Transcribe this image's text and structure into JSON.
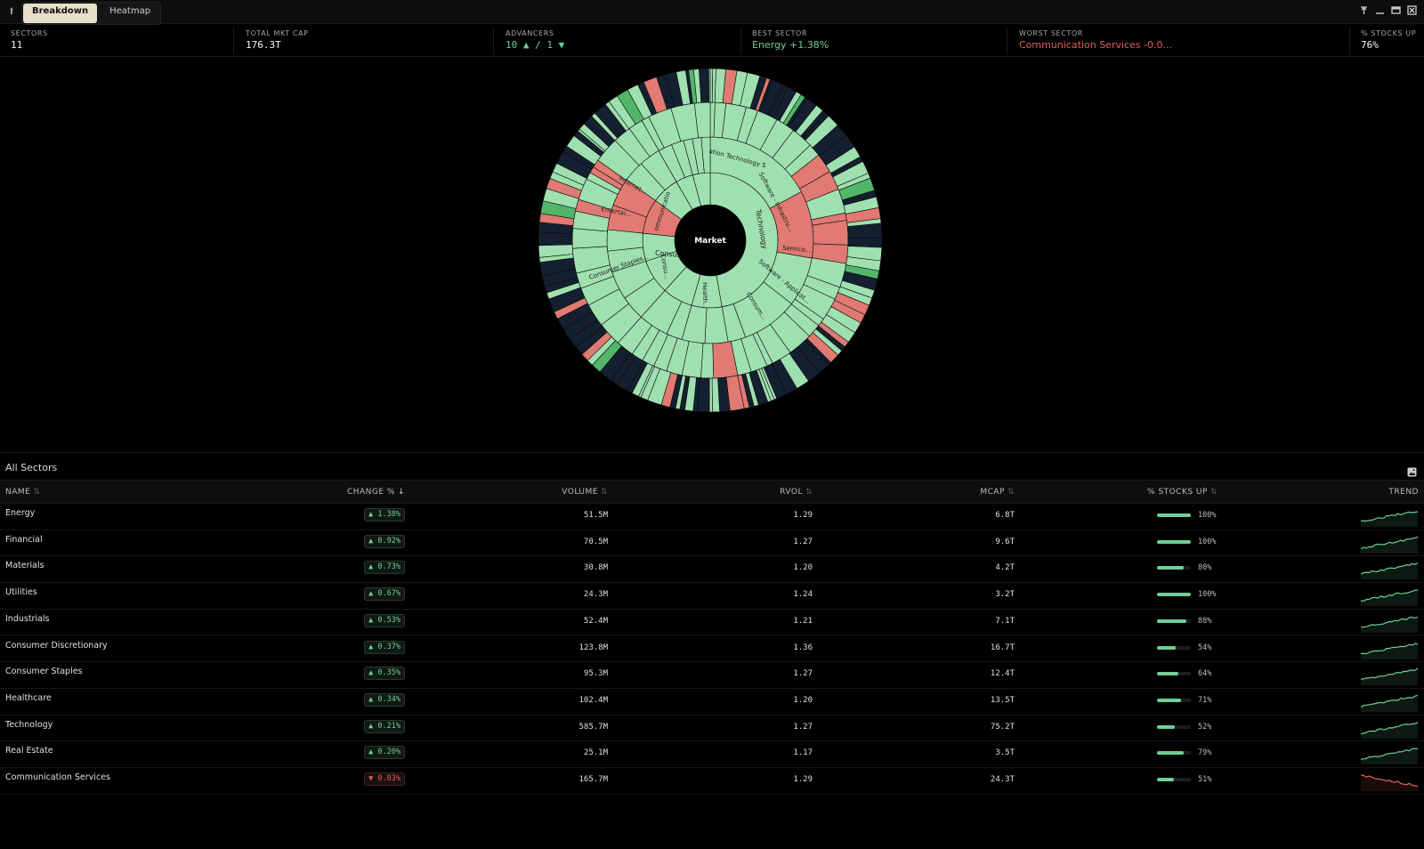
{
  "window": {
    "tabs": [
      {
        "label": "Breakdown",
        "active": true
      },
      {
        "label": "Heatmap",
        "active": false
      }
    ],
    "controls": [
      "pin-icon",
      "minimize-icon",
      "maximize-icon",
      "close-icon"
    ]
  },
  "stats": [
    {
      "label": "SECTORS",
      "value": "11",
      "tone": "neutral"
    },
    {
      "label": "TOTAL MKT CAP",
      "value": "176.3T",
      "tone": "neutral"
    },
    {
      "label": "ADVANCERS",
      "value": "10 ▲ / 1 ▼",
      "tone": "pos"
    },
    {
      "label": "BEST SECTOR",
      "value": "Energy +1.38%",
      "tone": "pos"
    },
    {
      "label": "WORST SECTOR",
      "value": "Communication Services -0.0...",
      "tone": "neg"
    },
    {
      "label": "% STOCKS UP",
      "value": "76%",
      "tone": "neutral"
    }
  ],
  "sunburst": {
    "center_label": "Market",
    "labels": [
      "ation Technology S",
      "Software - Infrastru...",
      "Technology",
      "Semico...",
      "Software - Applicat...",
      "Consum...",
      "Health...",
      "Consu...",
      "Consu...",
      "Consumer Staples...",
      "Entertai...",
      "Internet...",
      "ommunicatio"
    ],
    "colors": {
      "up": "#9fe0b0",
      "up_strong": "#52b56a",
      "down": "#e07a72",
      "dark": "#142030"
    }
  },
  "panel": {
    "title": "All Sectors",
    "columns": {
      "name": "NAME",
      "change": "CHANGE %",
      "volume": "VOLUME",
      "rvol": "RVOL",
      "mcap": "MCAP",
      "stocks_up": "% STOCKS UP",
      "trend": "TREND"
    },
    "sort_glyph": "⇅",
    "sort_active_glyph": "↓",
    "rows": [
      {
        "name": "Energy",
        "change": "1.38%",
        "dir": "up",
        "volume": "51.5M",
        "rvol": "1.29",
        "mcap": "6.8T",
        "stocks_up": "100%",
        "stocks_up_frac": 1.0
      },
      {
        "name": "Financial",
        "change": "0.92%",
        "dir": "up",
        "volume": "70.5M",
        "rvol": "1.27",
        "mcap": "9.6T",
        "stocks_up": "100%",
        "stocks_up_frac": 1.0
      },
      {
        "name": "Materials",
        "change": "0.73%",
        "dir": "up",
        "volume": "30.8M",
        "rvol": "1.20",
        "mcap": "4.2T",
        "stocks_up": "80%",
        "stocks_up_frac": 0.8
      },
      {
        "name": "Utilities",
        "change": "0.67%",
        "dir": "up",
        "volume": "24.3M",
        "rvol": "1.24",
        "mcap": "3.2T",
        "stocks_up": "100%",
        "stocks_up_frac": 1.0
      },
      {
        "name": "Industrials",
        "change": "0.53%",
        "dir": "up",
        "volume": "52.4M",
        "rvol": "1.21",
        "mcap": "7.1T",
        "stocks_up": "88%",
        "stocks_up_frac": 0.88
      },
      {
        "name": "Consumer Discretionary",
        "change": "0.37%",
        "dir": "up",
        "volume": "123.8M",
        "rvol": "1.36",
        "mcap": "16.7T",
        "stocks_up": "54%",
        "stocks_up_frac": 0.54
      },
      {
        "name": "Consumer Staples",
        "change": "0.35%",
        "dir": "up",
        "volume": "95.3M",
        "rvol": "1.27",
        "mcap": "12.4T",
        "stocks_up": "64%",
        "stocks_up_frac": 0.64
      },
      {
        "name": "Healthcare",
        "change": "0.34%",
        "dir": "up",
        "volume": "102.4M",
        "rvol": "1.20",
        "mcap": "13.5T",
        "stocks_up": "71%",
        "stocks_up_frac": 0.71
      },
      {
        "name": "Technology",
        "change": "0.21%",
        "dir": "up",
        "volume": "585.7M",
        "rvol": "1.27",
        "mcap": "75.2T",
        "stocks_up": "52%",
        "stocks_up_frac": 0.52
      },
      {
        "name": "Real Estate",
        "change": "0.20%",
        "dir": "up",
        "volume": "25.1M",
        "rvol": "1.17",
        "mcap": "3.5T",
        "stocks_up": "79%",
        "stocks_up_frac": 0.79
      },
      {
        "name": "Communication Services",
        "change": "0.03%",
        "dir": "down",
        "volume": "165.7M",
        "rvol": "1.29",
        "mcap": "24.3T",
        "stocks_up": "51%",
        "stocks_up_frac": 0.51
      }
    ]
  }
}
